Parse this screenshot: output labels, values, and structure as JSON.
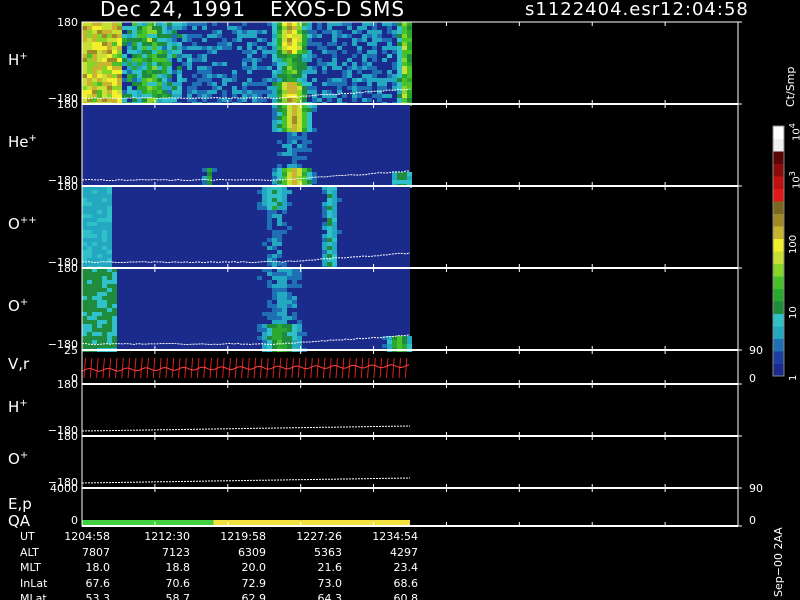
{
  "header": {
    "date": "Dec 24, 1991",
    "title": "EXOS-D SMS",
    "file": "s1122404.esr",
    "time": "12:04:58"
  },
  "colorbar": {
    "unit": "Ct/Smp",
    "ticks": [
      {
        "label": "1",
        "pos": 0.02
      },
      {
        "label": "10",
        "pos": 0.27
      },
      {
        "label": "100",
        "pos": 0.53
      },
      {
        "label": "10",
        "sup": "3",
        "pos": 0.79
      },
      {
        "label": "10",
        "sup": "4",
        "pos": 0.98
      }
    ],
    "colors": [
      "#1a2b8c",
      "#1c3fa0",
      "#1f6fb4",
      "#24a7c0",
      "#2fc0c8",
      "#1e8c3c",
      "#2aa830",
      "#48c22a",
      "#86d62a",
      "#c8e034",
      "#f2f02a",
      "#c8b430",
      "#a08a28",
      "#7a6820",
      "#e01818",
      "#c01010",
      "#8a0c0c",
      "#5a0606",
      "#f0f0f0",
      "#ffffff"
    ]
  },
  "panels": [
    {
      "id": "hplus-spectro",
      "label": "H",
      "sup": "+",
      "top_tick": "180",
      "bottom_tick": "−180"
    },
    {
      "id": "heplus-spectro",
      "label": "He",
      "sup": "+",
      "top_tick": "180",
      "bottom_tick": "−180"
    },
    {
      "id": "oplusplus-spectro",
      "label": "O",
      "sup": "++",
      "top_tick": "180",
      "bottom_tick": "−180"
    },
    {
      "id": "oplus-spectro",
      "label": "O",
      "sup": "+",
      "top_tick": "180",
      "bottom_tick": "−180"
    },
    {
      "id": "vr-panel",
      "label": "V,r",
      "top_tick": "25",
      "bottom_tick": "0",
      "right_top": "90",
      "right_bottom": "0"
    },
    {
      "id": "hplus-line",
      "label": "H",
      "sup": "+",
      "top_tick": "180",
      "bottom_tick": "−180"
    },
    {
      "id": "oplus-line",
      "label": "O",
      "sup": "+",
      "top_tick": "180",
      "bottom_tick": "−180"
    },
    {
      "id": "ep-qa",
      "label": "E,p",
      "label2": "QA",
      "top_tick": "4000",
      "bottom_tick": "0",
      "right_top": "90",
      "right_bottom": "0"
    }
  ],
  "chart_data": {
    "type": "heatmap",
    "data_end_fraction": 0.5,
    "qa_bar": [
      {
        "from": 0,
        "to": 0.4,
        "color": "#40d040"
      },
      {
        "from": 0.4,
        "to": 1.0,
        "color": "#f0e040"
      }
    ],
    "ephemeris": {
      "rows": [
        {
          "name": "UT",
          "values": [
            "1204:58",
            "1212:30",
            "1219:58",
            "1227:26",
            "1234:54"
          ]
        },
        {
          "name": "ALT",
          "values": [
            "7807",
            "7123",
            "6309",
            "5363",
            "4297"
          ]
        },
        {
          "name": "MLT",
          "values": [
            "18.0",
            "18.8",
            "20.0",
            "21.6",
            "23.4"
          ]
        },
        {
          "name": "InLat",
          "values": [
            "67.6",
            "70.6",
            "72.9",
            "73.0",
            "68.6"
          ]
        },
        {
          "name": "MLat",
          "values": [
            "53.3",
            "58.7",
            "62.9",
            "64.3",
            "60.8"
          ]
        }
      ]
    }
  },
  "footer": {
    "stamp": "Sep−00 2AA"
  }
}
